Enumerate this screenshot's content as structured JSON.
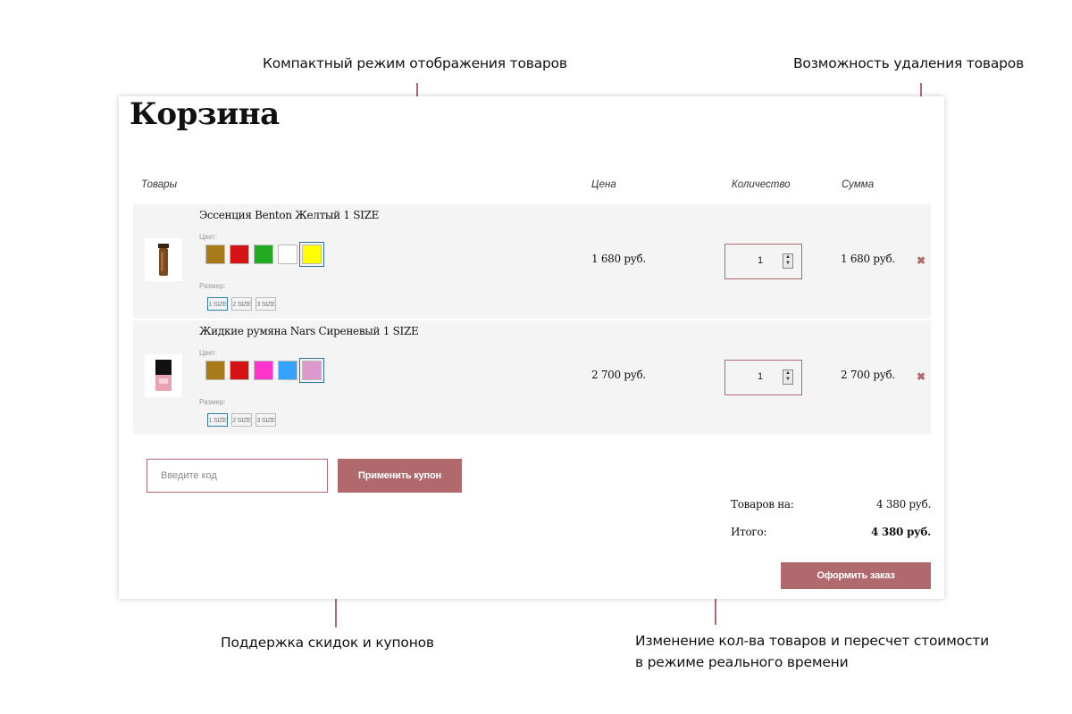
{
  "annotations": {
    "compact": "Компактный режим отображения товаров",
    "remove": "Возможность удаления товаров",
    "coupons": "Поддержка скидок и купонов",
    "realtime_line1": "Изменение кол-ва товаров и пересчет стоимости",
    "realtime_line2": "в режиме реального времени"
  },
  "colors": {
    "accent": "#b06a6d",
    "row_bg": "#f4f4f4",
    "selected_outline": "#2a6fa0"
  },
  "cart": {
    "title": "Корзина",
    "headers": {
      "products": "Товары",
      "price": "Цена",
      "quantity": "Количество",
      "sum": "Сумма"
    },
    "items": [
      {
        "name": "Эссенция Benton Желтый 1 SIZE",
        "color_label": "Цвет:",
        "size_label": "Размер:",
        "swatches": [
          "#a87a18",
          "#d41414",
          "#22aa22",
          "#ffffff",
          "#ffff00"
        ],
        "selected_swatch": 4,
        "sizes": [
          "1 SIZE",
          "2 SIZE",
          "3 SIZE"
        ],
        "selected_size": 0,
        "price": "1 680 руб.",
        "quantity": "1",
        "sum": "1 680 руб.",
        "thumb_icon": "essence-bottle-icon"
      },
      {
        "name": "Жидкие румяна Nars Сиреневый 1 SIZE",
        "color_label": "Цвет:",
        "size_label": "Размер:",
        "swatches": [
          "#a87a18",
          "#d41414",
          "#ff33cc",
          "#33a3ff",
          "#dd99cc"
        ],
        "selected_swatch": 4,
        "sizes": [
          "1 SIZE",
          "2 SIZE",
          "3 SIZE"
        ],
        "selected_size": 0,
        "price": "2 700 руб.",
        "quantity": "1",
        "sum": "2 700 руб.",
        "thumb_icon": "blush-bottle-icon"
      }
    ],
    "coupon": {
      "placeholder": "Введите код",
      "apply_label": "Применить купон"
    },
    "totals": {
      "subtotal_label": "Товаров на:",
      "subtotal_value": "4 380 руб.",
      "total_label": "Итого:",
      "total_value": "4 380 руб."
    },
    "checkout_label": "Оформить заказ"
  }
}
